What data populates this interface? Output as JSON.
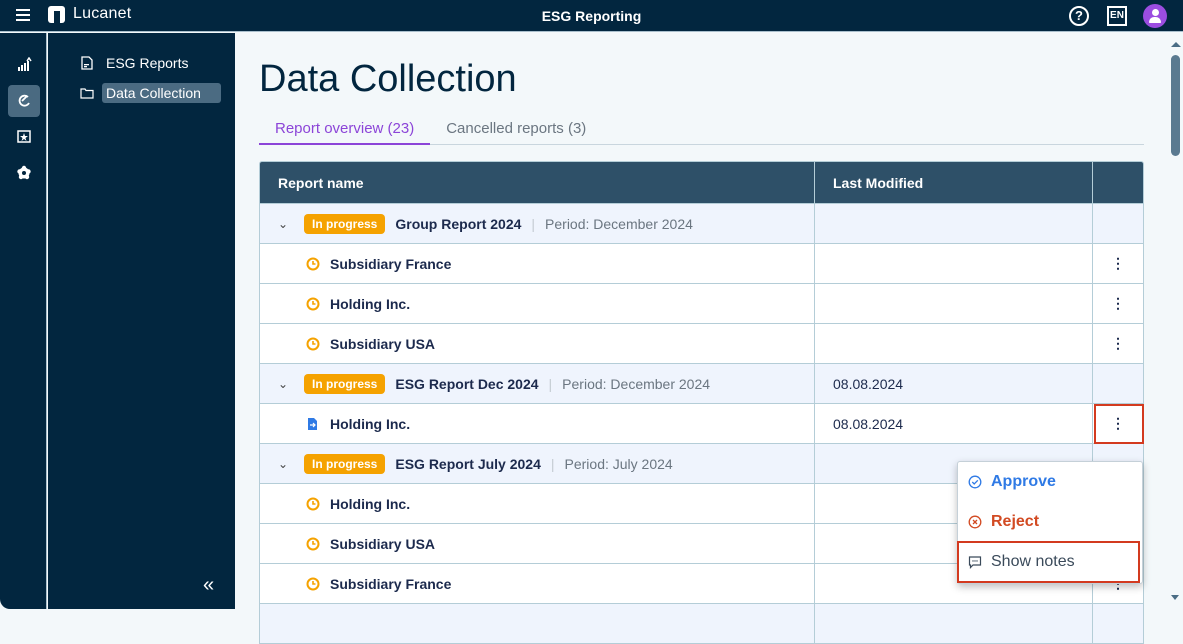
{
  "topbar": {
    "brand": "Lucanet",
    "app_title": "ESG Reporting",
    "help_icon": "?",
    "language": "EN"
  },
  "icon_rail": [
    {
      "name": "analytics-icon",
      "active": false
    },
    {
      "name": "data-collection-icon",
      "active": true
    },
    {
      "name": "starred-report-icon",
      "active": false
    },
    {
      "name": "settings-icon",
      "active": false
    }
  ],
  "sidenav": {
    "items": [
      {
        "label": "ESG Reports",
        "icon": "document-icon",
        "active": false
      },
      {
        "label": "Data Collection",
        "icon": "folder-icon",
        "active": true
      }
    ],
    "collapse_glyph": "«"
  },
  "page": {
    "title": "Data Collection",
    "tabs": [
      {
        "label": "Report overview (23)",
        "active": true
      },
      {
        "label": "Cancelled reports (3)",
        "active": false
      }
    ]
  },
  "table": {
    "columns": [
      "Report name",
      "Last Modified",
      ""
    ],
    "groups": [
      {
        "status": "In progress",
        "name": "Group Report 2024",
        "period": "Period: December 2024",
        "last_modified": "",
        "children": [
          {
            "name": "Subsidiary France",
            "icon": "clock-icon",
            "last_modified": ""
          },
          {
            "name": "Holding Inc.",
            "icon": "clock-icon",
            "last_modified": ""
          },
          {
            "name": "Subsidiary USA",
            "icon": "clock-icon",
            "last_modified": ""
          }
        ]
      },
      {
        "status": "In progress",
        "name": "ESG Report Dec 2024",
        "period": "Period: December 2024",
        "last_modified": "08.08.2024",
        "children": [
          {
            "name": "Holding Inc.",
            "icon": "document-submitted-icon",
            "last_modified": "08.08.2024"
          }
        ]
      },
      {
        "status": "In progress",
        "name": "ESG Report July 2024",
        "period": "Period: July 2024",
        "last_modified": "",
        "children": [
          {
            "name": "Holding Inc.",
            "icon": "clock-icon",
            "last_modified": ""
          },
          {
            "name": "Subsidiary USA",
            "icon": "clock-icon",
            "last_modified": ""
          },
          {
            "name": "Subsidiary France",
            "icon": "clock-icon",
            "last_modified": ""
          }
        ]
      }
    ]
  },
  "context_menu": {
    "items": [
      {
        "label": "Approve",
        "icon": "check-circle-icon"
      },
      {
        "label": "Reject",
        "icon": "x-circle-icon"
      },
      {
        "label": "Show notes",
        "icon": "comment-icon"
      }
    ]
  },
  "colors": {
    "brand_dark": "#02263f",
    "accent_purple": "#8c45d8",
    "status_in_progress": "#f5a200",
    "approve": "#2f7ae5",
    "reject": "#d24a22",
    "highlight": "#d33a1f"
  }
}
